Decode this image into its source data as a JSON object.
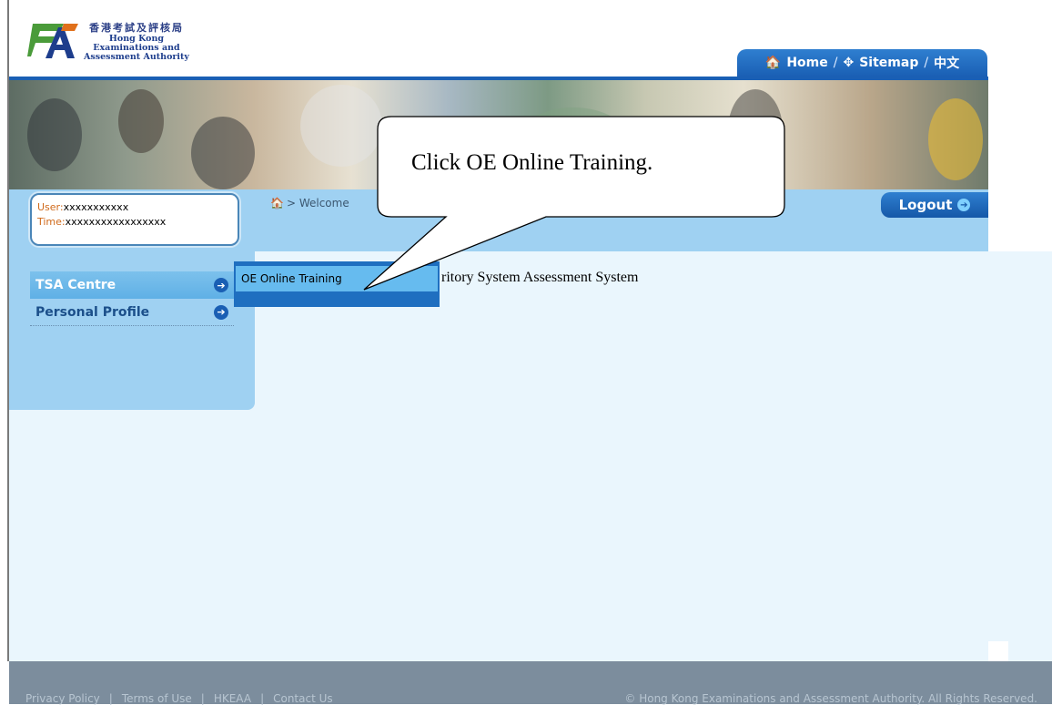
{
  "logo": {
    "chinese_name": "香港考試及評核局",
    "english_line1": "Hong Kong",
    "english_line2": "Examinations and",
    "english_line3": "Assessment Authority"
  },
  "topnav": {
    "home_label": "Home",
    "sitemap_label": "Sitemap",
    "language_label": "中文",
    "separator": "/"
  },
  "user_info": {
    "user_label": "User:",
    "user_value": "xxxxxxxxxxx",
    "time_label": "Time:",
    "time_value": "xxxxxxxxxxxxxxxxx"
  },
  "breadcrumb": {
    "current": "> Welcome"
  },
  "logout_label": "Logout",
  "sidebar": {
    "items": [
      {
        "label": "TSA Centre",
        "active": true
      },
      {
        "label": "Personal Profile",
        "active": false
      }
    ]
  },
  "submenu": {
    "items": [
      {
        "label": "OE Online Training"
      }
    ]
  },
  "main": {
    "welcome_text": "ritory System Assessment System"
  },
  "callout": {
    "text": "Click OE Online Training."
  },
  "footer": {
    "links": [
      "Privacy Policy",
      "Terms of Use",
      "HKEAA",
      "Contact Us"
    ],
    "separator": "|",
    "copyright": "© Hong Kong Examinations and Assessment Authority. All Rights Reserved."
  },
  "colors": {
    "brand_blue": "#1a5fb4",
    "panel_light": "#eaf6fd",
    "panel_mid": "#9fd1f2",
    "footer": "#7c8d9d"
  }
}
